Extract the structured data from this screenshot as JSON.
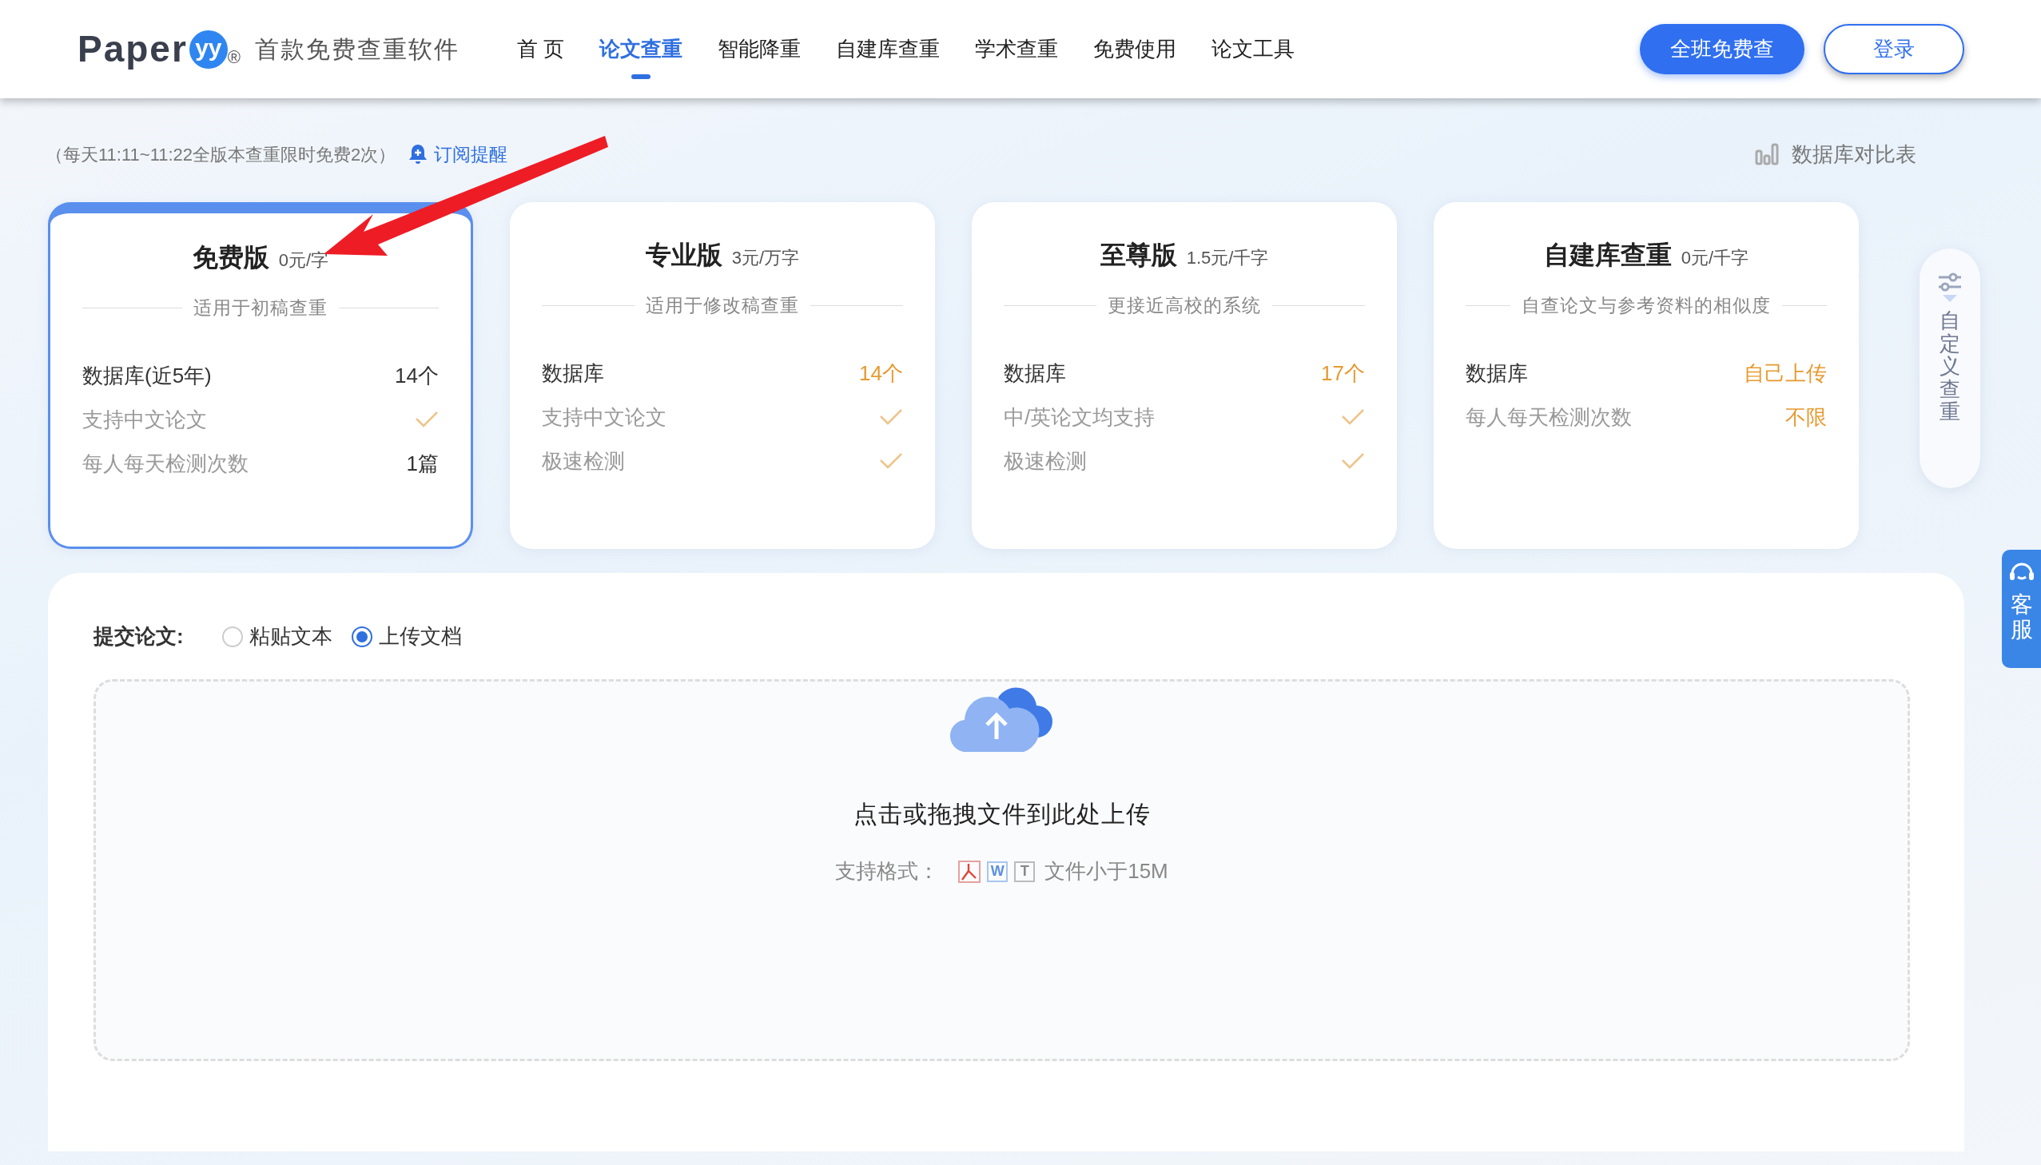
{
  "header": {
    "logo": {
      "name": "Paper",
      "mark": "yy",
      "registered": "®"
    },
    "slogan": "首款免费查重软件",
    "nav": [
      {
        "label": "首 页",
        "selected": false
      },
      {
        "label": "论文查重",
        "selected": true
      },
      {
        "label": "智能降重",
        "selected": false
      },
      {
        "label": "自建库查重",
        "selected": false
      },
      {
        "label": "学术查重",
        "selected": false
      },
      {
        "label": "免费使用",
        "selected": false
      },
      {
        "label": "论文工具",
        "selected": false
      }
    ],
    "buttons": [
      {
        "label": "全班免费查",
        "kind": "primary"
      },
      {
        "label": "登录",
        "kind": "outline"
      }
    ]
  },
  "notice": {
    "text": "（每天11:11~11:22全版本查重限时免费2次）",
    "subscribe": "订阅提醒",
    "compare": "数据库对比表"
  },
  "plans": [
    {
      "name": "免费版",
      "price": "0元/字",
      "subtitle": "适用于初稿查重",
      "selected": true,
      "rows": [
        {
          "label": "数据库(近5年)",
          "kind": "text",
          "value": "14个",
          "main": true,
          "accent": false
        },
        {
          "label": "支持中文论文",
          "kind": "check",
          "main": false
        },
        {
          "label": "每人每天检测次数",
          "kind": "text",
          "value": "1篇",
          "main": false,
          "accent": false
        }
      ]
    },
    {
      "name": "专业版",
      "price": "3元/万字",
      "subtitle": "适用于修改稿查重",
      "selected": false,
      "rows": [
        {
          "label": "数据库",
          "kind": "text",
          "value": "14个",
          "main": true,
          "accent": true
        },
        {
          "label": "支持中文论文",
          "kind": "check",
          "main": false
        },
        {
          "label": "极速检测",
          "kind": "check",
          "main": false
        }
      ]
    },
    {
      "name": "至尊版",
      "price": "1.5元/千字",
      "subtitle": "更接近高校的系统",
      "selected": false,
      "rows": [
        {
          "label": "数据库",
          "kind": "text",
          "value": "17个",
          "main": true,
          "accent": true
        },
        {
          "label": "中/英论文均支持",
          "kind": "check",
          "main": false
        },
        {
          "label": "极速检测",
          "kind": "check",
          "main": false
        }
      ]
    },
    {
      "name": "自建库查重",
      "price": "0元/千字",
      "subtitle": "自查论文与参考资料的相似度",
      "selected": false,
      "rows": [
        {
          "label": "数据库",
          "kind": "text",
          "value": "自己上传",
          "main": true,
          "accent": true
        },
        {
          "label": "每人每天检测次数",
          "kind": "text",
          "value": "不限",
          "main": false,
          "accent": true
        }
      ]
    }
  ],
  "side_tab": {
    "label": "自定义查重"
  },
  "service_tab": {
    "label": "客服"
  },
  "submit": {
    "label": "提交论文:",
    "options": [
      {
        "label": "粘贴文本",
        "selected": false
      },
      {
        "label": "上传文档",
        "selected": true
      }
    ],
    "upload": {
      "title": "点击或拖拽文件到此处上传",
      "formats_label": "支持格式：",
      "formats": [
        {
          "kind": "pdf"
        },
        {
          "kind": "word",
          "letter": "W"
        },
        {
          "kind": "txt",
          "letter": "T"
        }
      ],
      "size_note": "文件小于15M"
    }
  }
}
